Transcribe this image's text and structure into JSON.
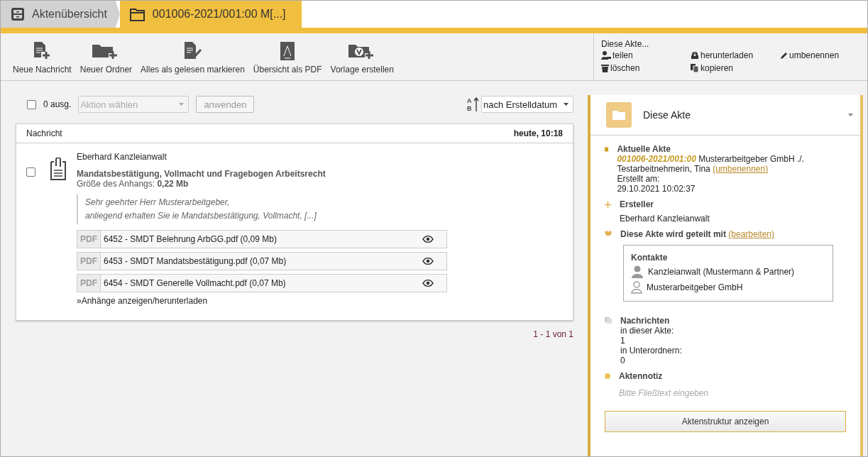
{
  "breadcrumbs": [
    {
      "label": "Aktenübersicht",
      "selected": false
    },
    {
      "label": "001006-2021/001:00 M[...]",
      "selected": true
    }
  ],
  "toolbar": {
    "buttons": [
      "Neue Nachricht",
      "Neuer Ordner",
      "Alles als gelesen markieren",
      "Übersicht als PDF",
      "Vorlage erstellen"
    ]
  },
  "file_actions": {
    "title": "Diese Akte...",
    "items": [
      "teilen",
      "herunterladen",
      "umbenennen",
      "löschen",
      "kopieren"
    ]
  },
  "list": {
    "select_all": {
      "checked": false
    },
    "selected_count": "0 ausg.",
    "action_select": {
      "placeholder": "Aktion wählen",
      "disabled": true
    },
    "apply_button": {
      "label": "anwenden",
      "disabled": true
    },
    "sort_order": [
      "A",
      "B"
    ],
    "sort_select": {
      "value": "nach Erstelldatum"
    },
    "header": {
      "column_1": "Nachricht",
      "date": "heute, 10:18"
    },
    "messages": [
      {
        "checked": false,
        "sender": "Eberhard Kanzleianwalt",
        "subject": "Mandatsbestätigung, Vollmacht und Fragebogen Arbeitsrecht",
        "size": "Größe des Anhangs: **0,22 Mb**",
        "preview": [
          "Sehr geehrter Herr Musterarbeitgeber,",
          "anliegend erhalten Sie ie Mandatsbestätigung, Vollmacht, [...]"
        ],
        "attachments": [
          {
            "type": "PDF",
            "name": "6452 - SMDT Belehrung ArbGG.pdf (0,09 Mb)"
          },
          {
            "type": "PDF",
            "name": "6453 - SMDT Mandatsbestätigung.pdf (0,07 Mb)"
          },
          {
            "type": "PDF",
            "name": "6454 - SMDT Generelle Vollmacht.pdf (0,07 Mb)"
          }
        ],
        "link": "»Anhänge anzeigen/herunterladen"
      }
    ],
    "pagination": "1 - 1 von 1"
  },
  "panel": {
    "title": "Diese Akte",
    "current": {
      "heading": "Aktuelle Akte",
      "number": "001006-2021/001:00",
      "name": "Musterarbeitgeber GmbH ./. Testarbeitnehmerin, Tina",
      "rename_link": "(umbenennen)",
      "created_label": "Erstellt am:",
      "created": "29.10.2021 10:02:37"
    },
    "creator": {
      "heading": "Ersteller",
      "name": "Eberhard Kanzleianwalt"
    },
    "shared": {
      "heading": "Diese Akte wird geteilt mit",
      "edit_link": "(bearbeiten)",
      "contacts_title": "Kontakte",
      "contacts": [
        {
          "name": "Kanzleianwalt (Mustermann & Partner)",
          "kind": "filled"
        },
        {
          "name": "Musterarbeitgeber GmbH",
          "kind": "outline"
        }
      ]
    },
    "messages": {
      "heading": "Nachrichten",
      "lines": [
        "in dieser Akte:",
        "1",
        "in Unterordnern:",
        "0"
      ]
    },
    "note": {
      "heading": "Aktennotiz",
      "placeholder": "Bitte Fließtext eingeben"
    },
    "structure_button": "Aktenstruktur anzeigen"
  }
}
